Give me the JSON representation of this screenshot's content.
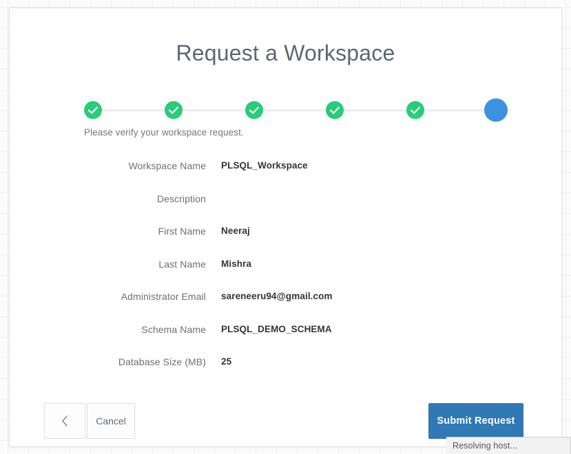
{
  "page": {
    "title": "Request a Workspace",
    "instruction": "Please verify your workspace request."
  },
  "stepper": {
    "steps": [
      {
        "index": 1,
        "state": "done",
        "icon": "check-icon"
      },
      {
        "index": 2,
        "state": "done",
        "icon": "check-icon"
      },
      {
        "index": 3,
        "state": "done",
        "icon": "check-icon"
      },
      {
        "index": 4,
        "state": "done",
        "icon": "check-icon"
      },
      {
        "index": 5,
        "state": "done",
        "icon": "check-icon"
      },
      {
        "index": 6,
        "state": "current",
        "icon": ""
      }
    ],
    "done_color": "#28cc79",
    "current_color": "#3c92e0",
    "track_color": "#ededed"
  },
  "summary": {
    "rows": [
      {
        "label": "Workspace Name",
        "value": "PLSQL_Workspace"
      },
      {
        "label": "Description",
        "value": ""
      },
      {
        "label": "First Name",
        "value": "Neeraj"
      },
      {
        "label": "Last Name",
        "value": "Mishra"
      },
      {
        "label": "Administrator Email",
        "value": "sareneeru94@gmail.com"
      },
      {
        "label": "Schema Name",
        "value": "PLSQL_DEMO_SCHEMA"
      },
      {
        "label": "Database Size (MB)",
        "value": "25"
      }
    ]
  },
  "footer": {
    "back_icon": "chevron-left-icon",
    "cancel_label": "Cancel",
    "submit_label": "Submit Request",
    "submit_color": "#3079b5"
  },
  "browser_status": {
    "text": "Resolving host..."
  }
}
